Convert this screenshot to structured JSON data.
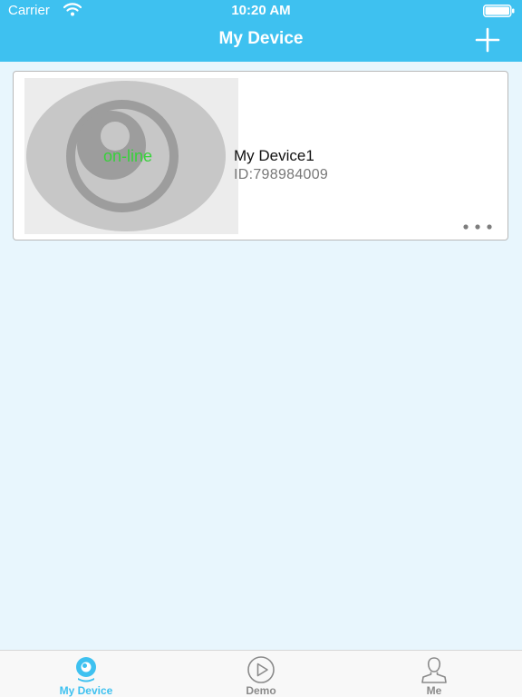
{
  "status_bar": {
    "carrier": "Carrier",
    "time": "10:20 AM"
  },
  "nav": {
    "title": "My Device",
    "add_icon": "plus-icon"
  },
  "devices": [
    {
      "name": "My Device1",
      "id_text": "ID:798984009",
      "status": "on-line",
      "status_color": "#37d23a"
    }
  ],
  "tabs": [
    {
      "label": "My Device",
      "icon": "camera-icon",
      "active": true
    },
    {
      "label": "Demo",
      "icon": "play-icon",
      "active": false
    },
    {
      "label": "Me",
      "icon": "person-icon",
      "active": false
    }
  ],
  "colors": {
    "accent": "#3ec1f0",
    "background": "#e8f6fd",
    "inactive": "#8a8a8a"
  }
}
